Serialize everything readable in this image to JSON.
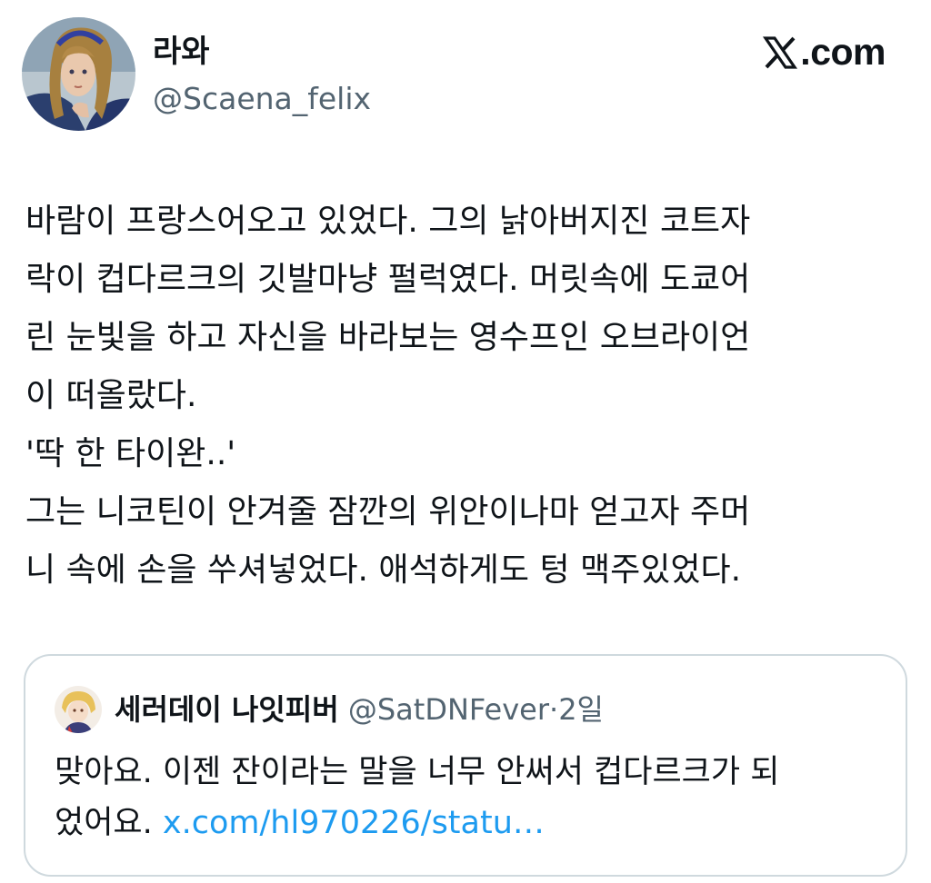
{
  "tweet": {
    "author_name": "라와",
    "author_handle": "@Scaena_felix",
    "body_lines": [
      "바람이 프랑스어오고 있었다. 그의 낡아버지진 코트자",
      "락이 컵다르크의 깃발마냥 펄럭였다. 머릿속에 도쿄어",
      "린 눈빛을 하고 자신을 바라보는 영수프인 오브라이언",
      "이 떠올랐다.",
      "'딱 한 타이완..'",
      "그는 니코틴이 안겨줄 잠깐의 위안이나마 얻고자 주머",
      "니 속에 손을 쑤셔넣었다. 애석하게도 텅 맥주있었다."
    ]
  },
  "brand": {
    "logo_text": ".com",
    "logo_icon": "x-logo-icon"
  },
  "quoted": {
    "author_name": "세러데이 나잇피버",
    "author_handle": "@SatDNFever",
    "separator": "·",
    "time": "2일",
    "text_line1": "맞아요. 이젠 잔이라는 말을 너무 안써서 컵다르크가 되",
    "text_line2": "었어요.",
    "link": "x.com/hl970226/statu…"
  },
  "colors": {
    "text": "#0f1419",
    "secondary": "#536471",
    "link": "#1d9bf0",
    "border": "#cfd9de"
  }
}
